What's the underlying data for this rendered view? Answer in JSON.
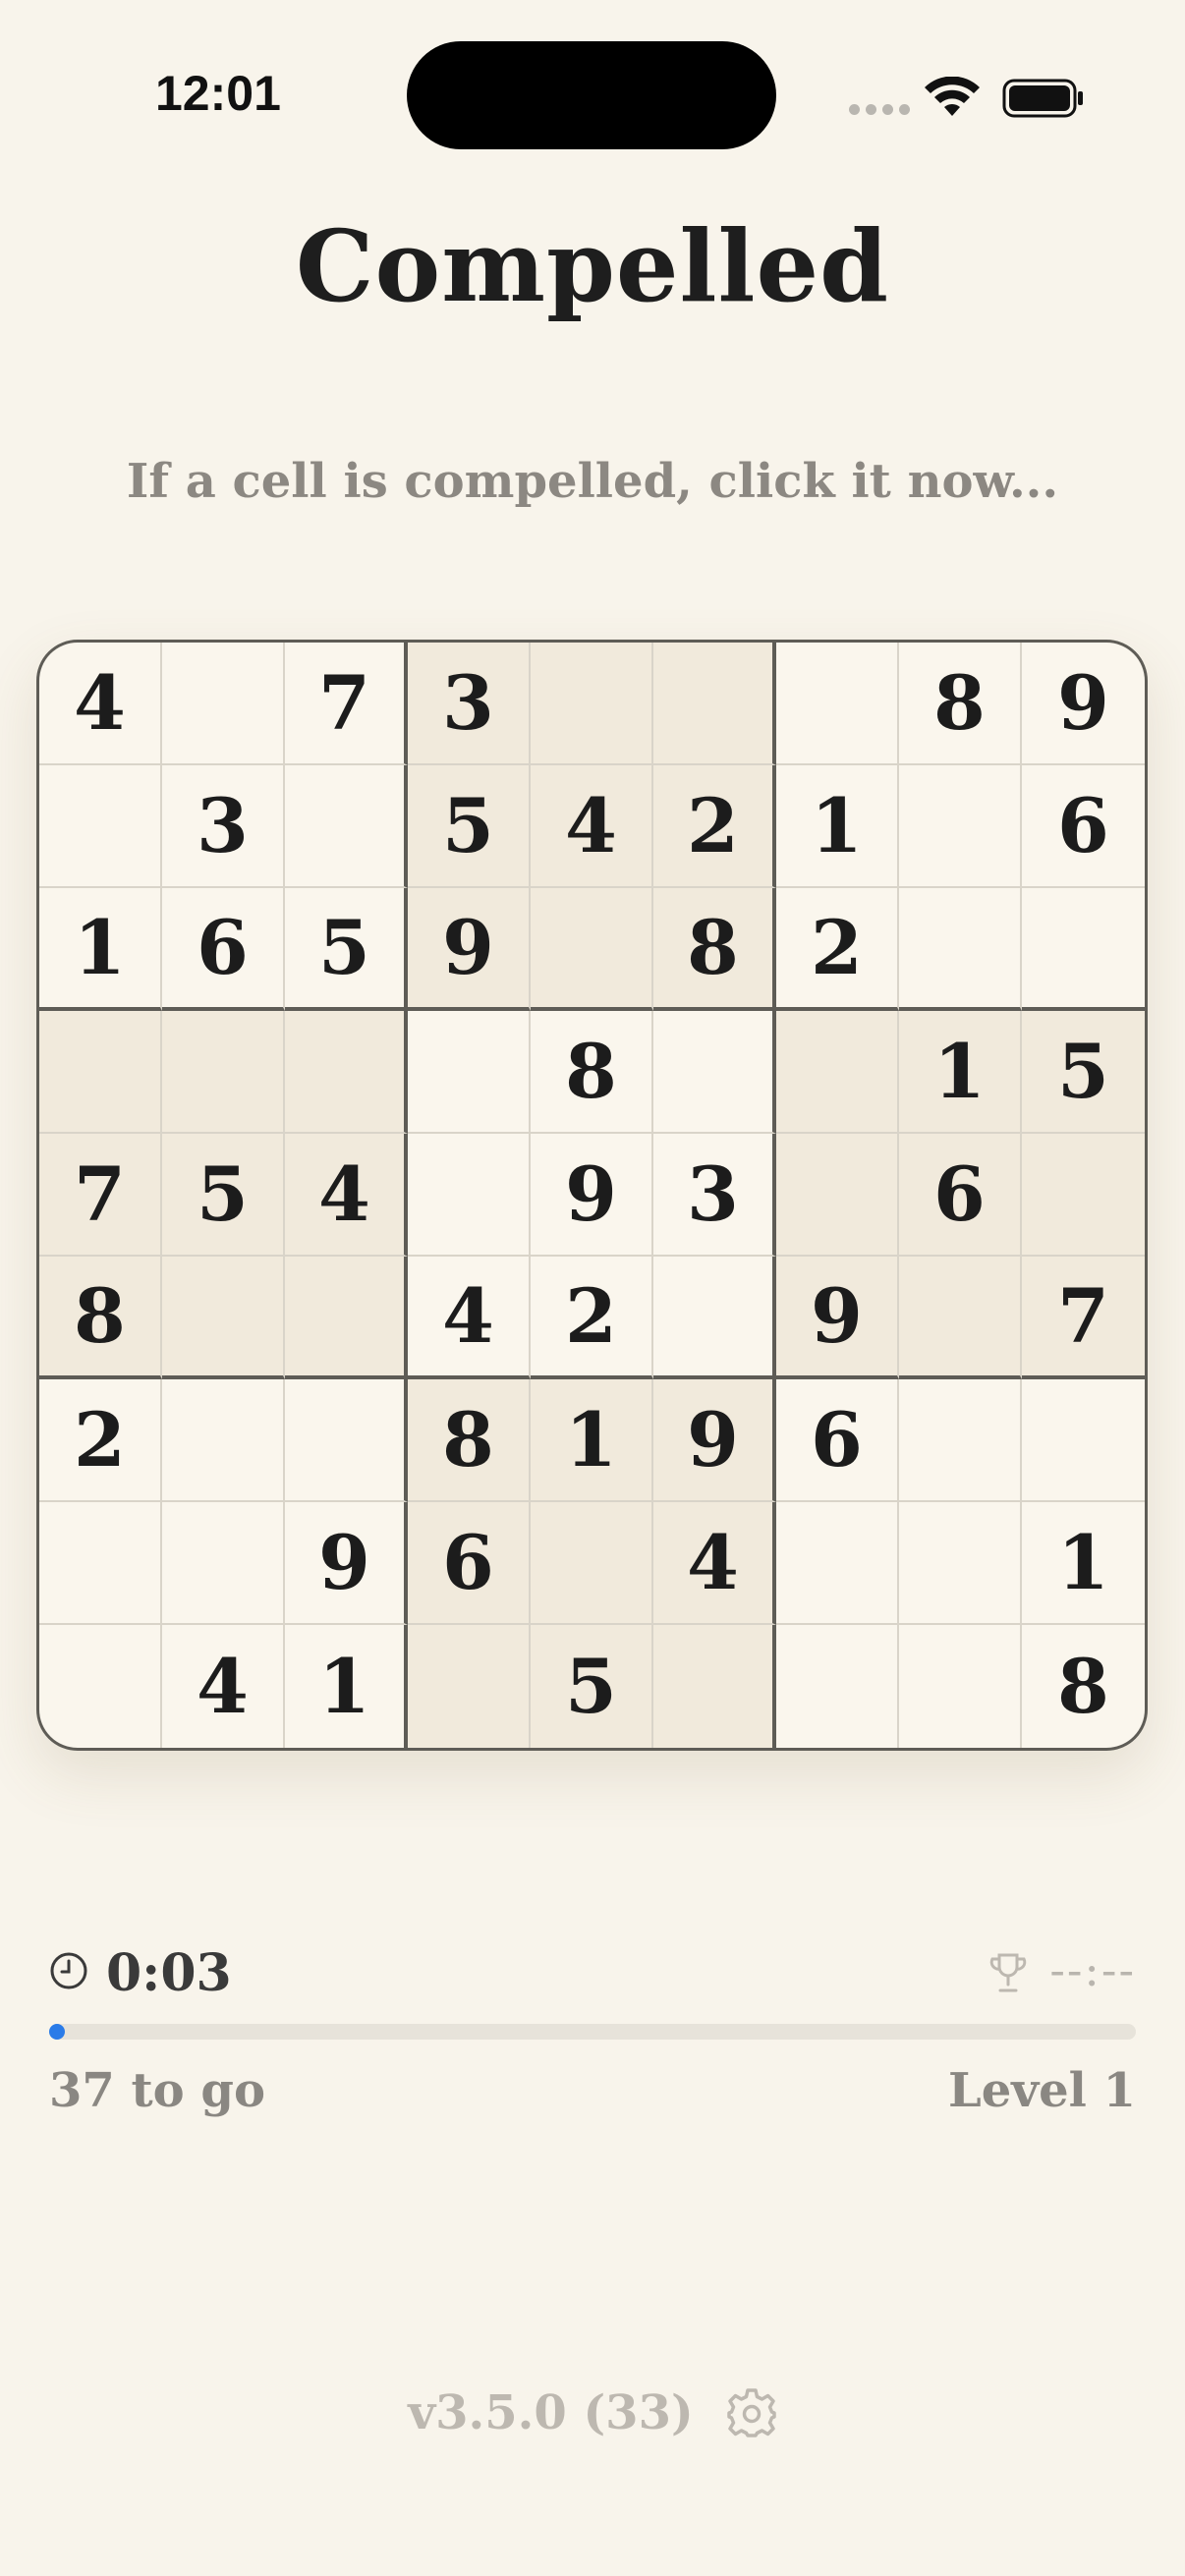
{
  "status_bar": {
    "time": "12:01"
  },
  "title": "Compelled",
  "subtitle": "If a cell is compelled, click it now...",
  "grid": [
    [
      "4",
      "",
      "7",
      "3",
      "",
      "",
      "",
      "8",
      "9"
    ],
    [
      "",
      "3",
      "",
      "5",
      "4",
      "2",
      "1",
      "",
      "6"
    ],
    [
      "1",
      "6",
      "5",
      "9",
      "",
      "8",
      "2",
      "",
      ""
    ],
    [
      "",
      "",
      "",
      "",
      "8",
      "",
      "",
      "1",
      "5"
    ],
    [
      "7",
      "5",
      "4",
      "",
      "9",
      "3",
      "",
      "6",
      ""
    ],
    [
      "8",
      "",
      "",
      "4",
      "2",
      "",
      "9",
      "",
      "7"
    ],
    [
      "2",
      "",
      "",
      "8",
      "1",
      "9",
      "6",
      "",
      ""
    ],
    [
      "",
      "",
      "9",
      "6",
      "",
      "4",
      "",
      "",
      "1"
    ],
    [
      "",
      "4",
      "1",
      "",
      "5",
      "",
      "",
      "",
      "8"
    ]
  ],
  "timer": {
    "elapsed": "0:03",
    "best": "--:--"
  },
  "progress": {
    "fraction": 0.006,
    "remaining_label": "37 to go",
    "level_label": "Level 1"
  },
  "footer": {
    "version": "v3.5.0 (33)"
  },
  "colors": {
    "accent": "#2a7be8",
    "shaded_box": "#f1eadc",
    "background": "#f8f4eb"
  },
  "icons": {
    "clock": "clock-icon",
    "trophy": "trophy-icon",
    "settings": "gear-icon"
  }
}
